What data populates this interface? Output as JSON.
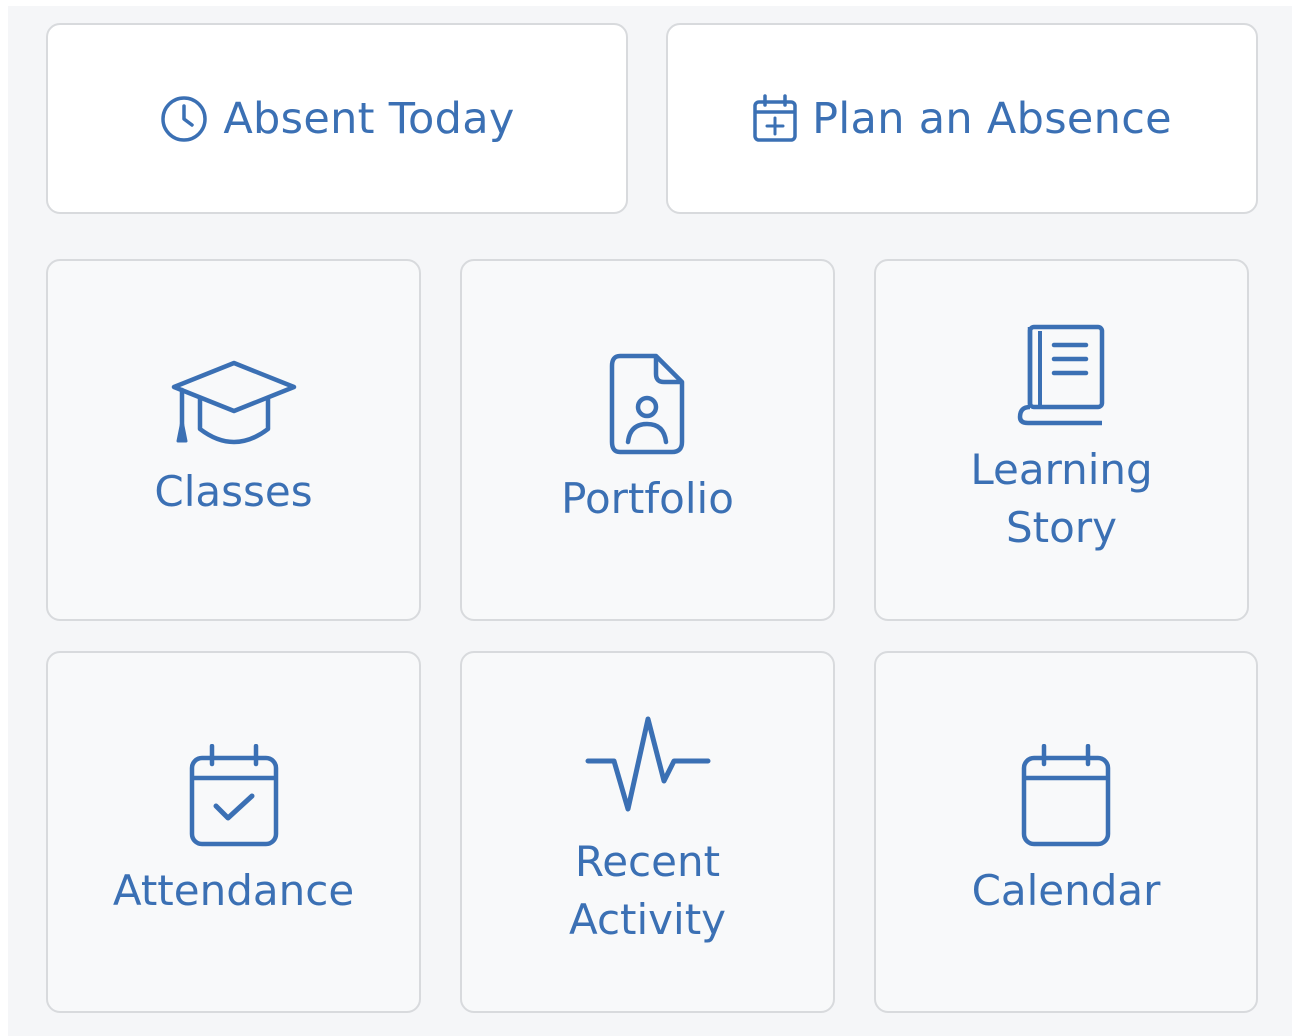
{
  "colors": {
    "accent": "#3b70b4",
    "tile_border": "#d8dadd",
    "tile_background": "#f8f9fa",
    "panel_background": "#f5f6f8"
  },
  "quick_actions": [
    {
      "label": "Absent Today",
      "icon": "clock-icon"
    },
    {
      "label": "Plan an Absence",
      "icon": "calendar-plus-icon"
    }
  ],
  "menu_tiles": [
    {
      "label": "Classes",
      "icon": "graduation-cap-icon"
    },
    {
      "label": "Portfolio",
      "icon": "portfolio-document-icon"
    },
    {
      "label": "Learning\nStory",
      "icon": "book-icon"
    },
    {
      "label": "Attendance",
      "icon": "calendar-check-icon"
    },
    {
      "label": "Recent\nActivity",
      "icon": "activity-pulse-icon"
    },
    {
      "label": "Calendar",
      "icon": "calendar-icon"
    }
  ]
}
